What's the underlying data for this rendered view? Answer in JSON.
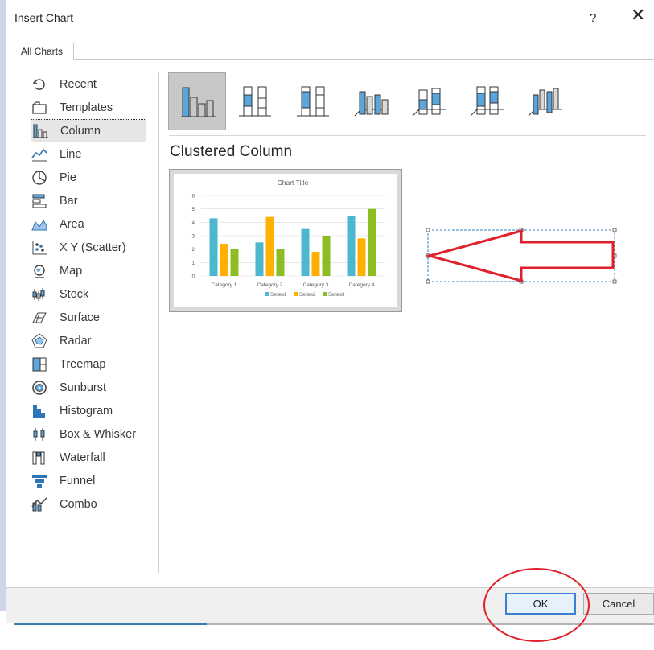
{
  "dialog": {
    "title": "Insert Chart",
    "help": "?",
    "close": "✕"
  },
  "tabs": [
    {
      "label": "All Charts"
    }
  ],
  "chart_types": [
    {
      "label": "Recent",
      "icon": "recent-icon"
    },
    {
      "label": "Templates",
      "icon": "templates-icon"
    },
    {
      "label": "Column",
      "icon": "column-chart-icon",
      "selected": true
    },
    {
      "label": "Line",
      "icon": "line-chart-icon"
    },
    {
      "label": "Pie",
      "icon": "pie-chart-icon"
    },
    {
      "label": "Bar",
      "icon": "bar-chart-icon"
    },
    {
      "label": "Area",
      "icon": "area-chart-icon"
    },
    {
      "label": "X Y (Scatter)",
      "icon": "scatter-chart-icon"
    },
    {
      "label": "Map",
      "icon": "map-chart-icon"
    },
    {
      "label": "Stock",
      "icon": "stock-chart-icon"
    },
    {
      "label": "Surface",
      "icon": "surface-chart-icon"
    },
    {
      "label": "Radar",
      "icon": "radar-chart-icon"
    },
    {
      "label": "Treemap",
      "icon": "treemap-chart-icon"
    },
    {
      "label": "Sunburst",
      "icon": "sunburst-chart-icon"
    },
    {
      "label": "Histogram",
      "icon": "histogram-chart-icon"
    },
    {
      "label": "Box & Whisker",
      "icon": "box-whisker-chart-icon"
    },
    {
      "label": "Waterfall",
      "icon": "waterfall-chart-icon"
    },
    {
      "label": "Funnel",
      "icon": "funnel-chart-icon"
    },
    {
      "label": "Combo",
      "icon": "combo-chart-icon"
    }
  ],
  "subtypes": [
    {
      "icon": "clustered-column-icon",
      "selected": true
    },
    {
      "icon": "stacked-column-icon"
    },
    {
      "icon": "100-stacked-column-icon"
    },
    {
      "icon": "3d-clustered-column-icon"
    },
    {
      "icon": "3d-stacked-column-icon"
    },
    {
      "icon": "3d-100-stacked-column-icon"
    },
    {
      "icon": "3d-column-icon"
    }
  ],
  "selected_subtype_title": "Clustered Column",
  "buttons": {
    "ok": "OK",
    "cancel": "Cancel"
  },
  "colors": {
    "series1": "#4bb8d0",
    "series2": "#ffb000",
    "series3": "#8cbe22",
    "accent": "#3c7fd3",
    "annotation": "#e0202a"
  },
  "progress": 0.3,
  "chart_data": {
    "type": "bar",
    "title": "Chart Title",
    "categories": [
      "Category 1",
      "Category 2",
      "Category 3",
      "Category 4"
    ],
    "series": [
      {
        "name": "Series1",
        "values": [
          4.3,
          2.5,
          3.5,
          4.5
        ]
      },
      {
        "name": "Series2",
        "values": [
          2.4,
          4.4,
          1.8,
          2.8
        ]
      },
      {
        "name": "Series3",
        "values": [
          2,
          2,
          3,
          5
        ]
      }
    ],
    "ylim": [
      0,
      6
    ],
    "yticks": [
      "0",
      "1",
      "2",
      "3",
      "4",
      "5",
      "6"
    ],
    "grid": true,
    "legend": "bottom"
  }
}
